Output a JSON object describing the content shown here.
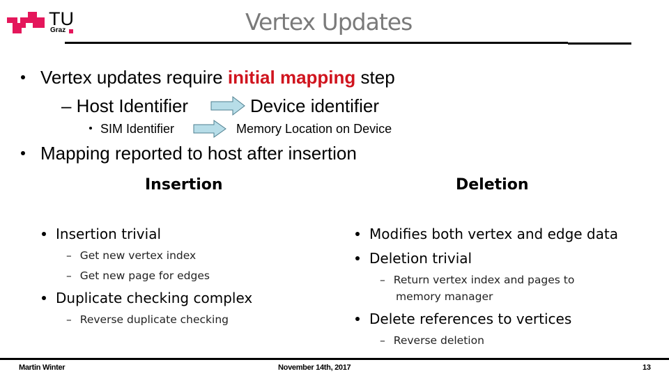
{
  "header": {
    "logo": {
      "name": "TU Graz",
      "main": "TU",
      "sub": "Graz",
      "color": "#e4175b"
    },
    "title": "Vertex Updates"
  },
  "intro": {
    "bullet1": {
      "prefix": "Vertex updates require ",
      "highlight": "initial mapping",
      "suffix": " step",
      "highlight_color": "#d0141e"
    },
    "sub1": {
      "from": "– Host Identifier",
      "to": "Device identifier",
      "arrow_icon": "right-arrow-icon"
    },
    "subsub1": {
      "from": "SIM Identifier",
      "to": "Memory Location on Device",
      "arrow_icon": "right-arrow-icon"
    },
    "bullet2": "Mapping reported to host after insertion",
    "arrow_color": "#b7dde8"
  },
  "insertion": {
    "heading": "Insertion",
    "items": [
      {
        "text": "Insertion trivial",
        "subs": [
          "Get new vertex index",
          "Get new page for edges"
        ]
      },
      {
        "text": "Duplicate checking complex",
        "subs": [
          "Reverse duplicate checking"
        ]
      }
    ]
  },
  "deletion": {
    "heading": "Deletion",
    "items": [
      {
        "text": "Modifies both vertex and edge data",
        "subs": []
      },
      {
        "text": "Deletion trivial",
        "subs": [
          "Return vertex index and pages to",
          "memory manager"
        ]
      },
      {
        "text": "Delete references to vertices",
        "subs": [
          "Reverse deletion"
        ]
      }
    ]
  },
  "footer": {
    "author": "Martin Winter",
    "date": "November 14th, 2017",
    "page": "13"
  }
}
